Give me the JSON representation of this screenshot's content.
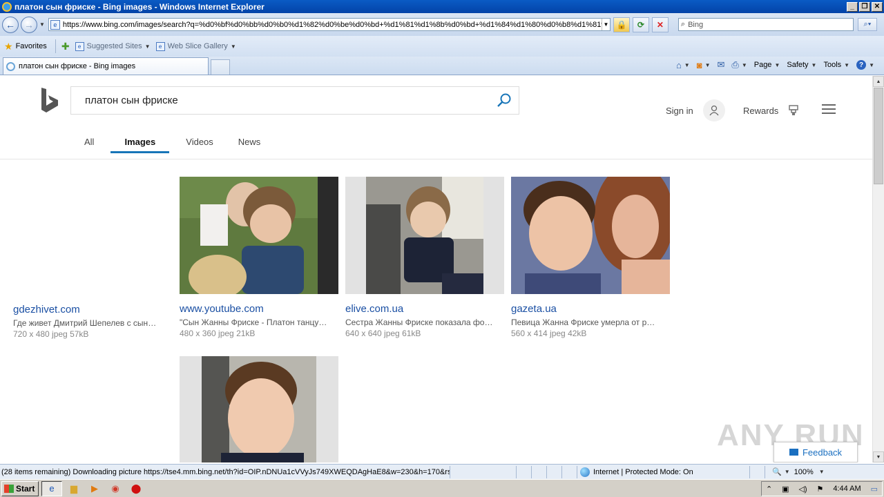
{
  "window": {
    "title": "платон сын фриске - Bing images - Windows Internet Explorer"
  },
  "address_bar": {
    "url": "https://www.bing.com/images/search?q=%d0%bf%d0%bb%d0%b0%d1%82%d0%be%d0%bd+%d1%81%d1%8b%d0%bd+%d1%84%d1%80%d0%b8%d1%81%d0%ba%d0%b5",
    "search_placeholder": "Bing"
  },
  "favorites_bar": {
    "favorites_label": "Favorites",
    "suggested_sites_label": "Suggested Sites",
    "web_slice_label": "Web Slice Gallery"
  },
  "tabs": [
    {
      "label": "платон сын фриске - Bing images"
    }
  ],
  "command_bar": {
    "page_label": "Page",
    "safety_label": "Safety",
    "tools_label": "Tools"
  },
  "bing": {
    "query": "платон сын фриске",
    "sign_in_label": "Sign in",
    "rewards_label": "Rewards",
    "scopes": [
      {
        "label": "All"
      },
      {
        "label": "Images"
      },
      {
        "label": "Videos"
      },
      {
        "label": "News"
      }
    ],
    "results": [
      {
        "source": "gdezhivet.com",
        "description": "Где живет Дмитрий Шепелев с сын…",
        "meta": "720 x 480 jpeg 57kB"
      },
      {
        "source": "www.youtube.com",
        "description": "\"Сын Жанны Фриске - Платон танцу…",
        "meta": "480 x 360 jpeg 21kB"
      },
      {
        "source": "elive.com.ua",
        "description": "Сестра Жанны Фриске показала фо…",
        "meta": "640 x 640 jpeg 61kB"
      },
      {
        "source": "gazeta.ua",
        "description": "Певица Жанна Фриске умерла от р…",
        "meta": "560 x 414 jpeg 42kB"
      }
    ],
    "feedback_label": "Feedback",
    "watermark": "ANY RUN"
  },
  "status_bar": {
    "text": "(28 items remaining) Downloading picture https://tse4.mm.bing.net/th?id=OIP.nDNUa1cVVyJs749XWEQDAgHaE8&w=230&h=170&rs=1",
    "zone": "Internet | Protected Mode: On",
    "zoom": "100%"
  },
  "taskbar": {
    "start_label": "Start",
    "clock": "4:44 AM"
  }
}
